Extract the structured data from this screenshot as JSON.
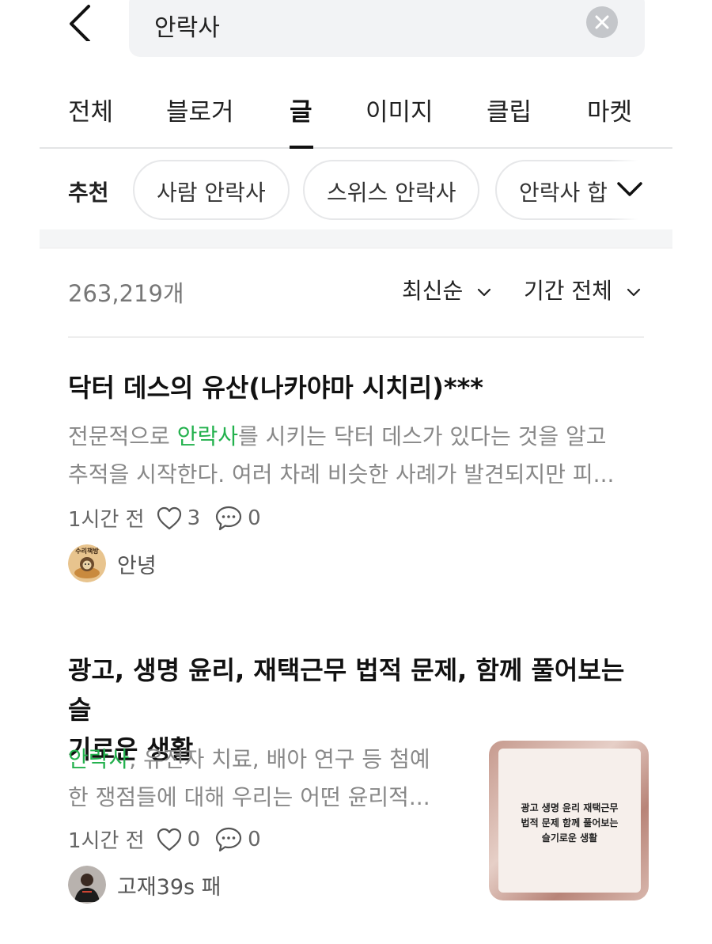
{
  "search": {
    "query": "안락사"
  },
  "tabs": [
    "전체",
    "블로거",
    "글",
    "이미지",
    "클립",
    "마켓"
  ],
  "recommend": {
    "label": "추천",
    "chips": [
      "사람 안락사",
      "스위스 안락사",
      "안락사 합"
    ]
  },
  "results": {
    "count": "263,219개",
    "sort_label": "최신순",
    "period_label": "기간 전체"
  },
  "posts": [
    {
      "title": "닥터 데스의 유산(나카야마 시치리)***",
      "snippet_line1_pre": "전문적으로 ",
      "snippet_highlight": "안락사",
      "snippet_line1_post": "를 시키는 닥터 데스가 있다는 것을 알고",
      "snippet_line2": "추적을 시작한다. 여러 차례 비슷한 사례가 발견되지만 피...",
      "time": "1시간 전",
      "likes": "3",
      "comments": "0",
      "author": "안녕",
      "avatar_text": "수리책방"
    },
    {
      "title_line1": "광고, 생명 윤리, 재택근무 법적 문제, 함께 풀어보는 슬",
      "title_line2": "기로운 생활",
      "snippet_highlight": "안락사",
      "snippet_line1_post": ", 유전자 치료, 배아 연구 등 첨예",
      "snippet_line2": "한 쟁점들에 대해 우리는 어떤 윤리적...",
      "time": "1시간 전",
      "likes": "0",
      "comments": "0",
      "author": "고재39s 패",
      "thumbnail_text": [
        "광고 생명 윤리 재택근무",
        "법적 문제 함께 풀어보는",
        "슬기로운 생활"
      ]
    }
  ],
  "colors": {
    "highlight": "#23b14d",
    "search_bg": "#f2f3f5"
  }
}
